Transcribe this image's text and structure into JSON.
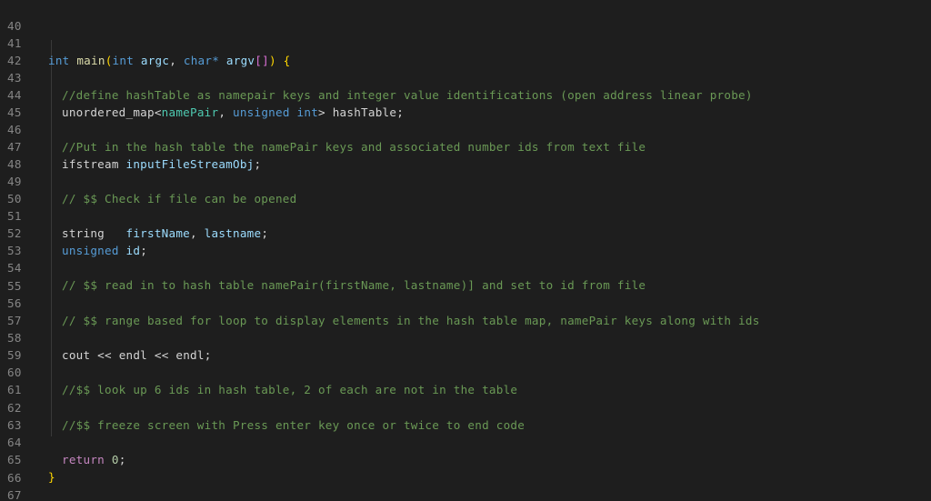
{
  "editor": {
    "line_numbers": [
      "40",
      "41",
      "42",
      "43",
      "44",
      "45",
      "46",
      "47",
      "48",
      "49",
      "50",
      "51",
      "52",
      "53",
      "54",
      "55",
      "56",
      "57",
      "58",
      "59",
      "60",
      "61",
      "62",
      "63",
      "64",
      "65",
      "66",
      "67"
    ],
    "tokens": {
      "l41_int": "int",
      "l41_main": "main",
      "l41_paren_open": "(",
      "l41_int2": "int",
      "l41_argc": "argc",
      "l41_comma": ", ",
      "l41_char": "char",
      "l41_star": "*",
      "l41_argv": "argv",
      "l41_brackets": "[]",
      "l41_paren_close": ")",
      "l41_brace": "{",
      "l43_comment": "//define hashTable as namepair keys and integer value identifications (open address linear probe)",
      "l44_map": "unordered_map",
      "l44_lt": "<",
      "l44_namePair": "namePair",
      "l44_comma": ", ",
      "l44_unsigned": "unsigned",
      "l44_int": "int",
      "l44_gt": ">",
      "l44_hashTable": "hashTable",
      "l44_semi": ";",
      "l46_comment": "//Put in the hash table the namePair keys and associated number ids from text file",
      "l47_ifstream": "ifstream",
      "l47_obj": "inputFileStreamObj",
      "l47_semi": ";",
      "l49_comment": "// $$ Check if file can be opened",
      "l51_string": "string",
      "l51_firstName": "firstName",
      "l51_comma": ", ",
      "l51_lastname": "lastname",
      "l51_semi": ";",
      "l52_unsigned": "unsigned",
      "l52_id": "id",
      "l52_semi": ";",
      "l54_comment": "// $$ read in to hash table namePair(firstName, lastname)] and set to id from file",
      "l56_comment": "// $$ range based for loop to display elements in the hash table map, namePair keys along with ids",
      "l58_cout": "cout",
      "l58_op1": " << ",
      "l58_endl1": "endl",
      "l58_op2": " << ",
      "l58_endl2": "endl",
      "l58_semi": ";",
      "l60_comment": "//$$ look up 6 ids in hash table, 2 of each are not in the table",
      "l62_comment": "//$$ freeze screen with Press enter key once or twice to end code",
      "l64_return": "return",
      "l64_zero": "0",
      "l64_semi": ";",
      "l65_brace": "}"
    }
  },
  "colors": {
    "background": "#1e1e1e",
    "keyword": "#569cd6",
    "function": "#dcdcaa",
    "variable": "#9cdcfe",
    "type": "#4ec9b0",
    "comment": "#6a9955",
    "plain": "#d4d4d4",
    "line_number": "#858585"
  }
}
